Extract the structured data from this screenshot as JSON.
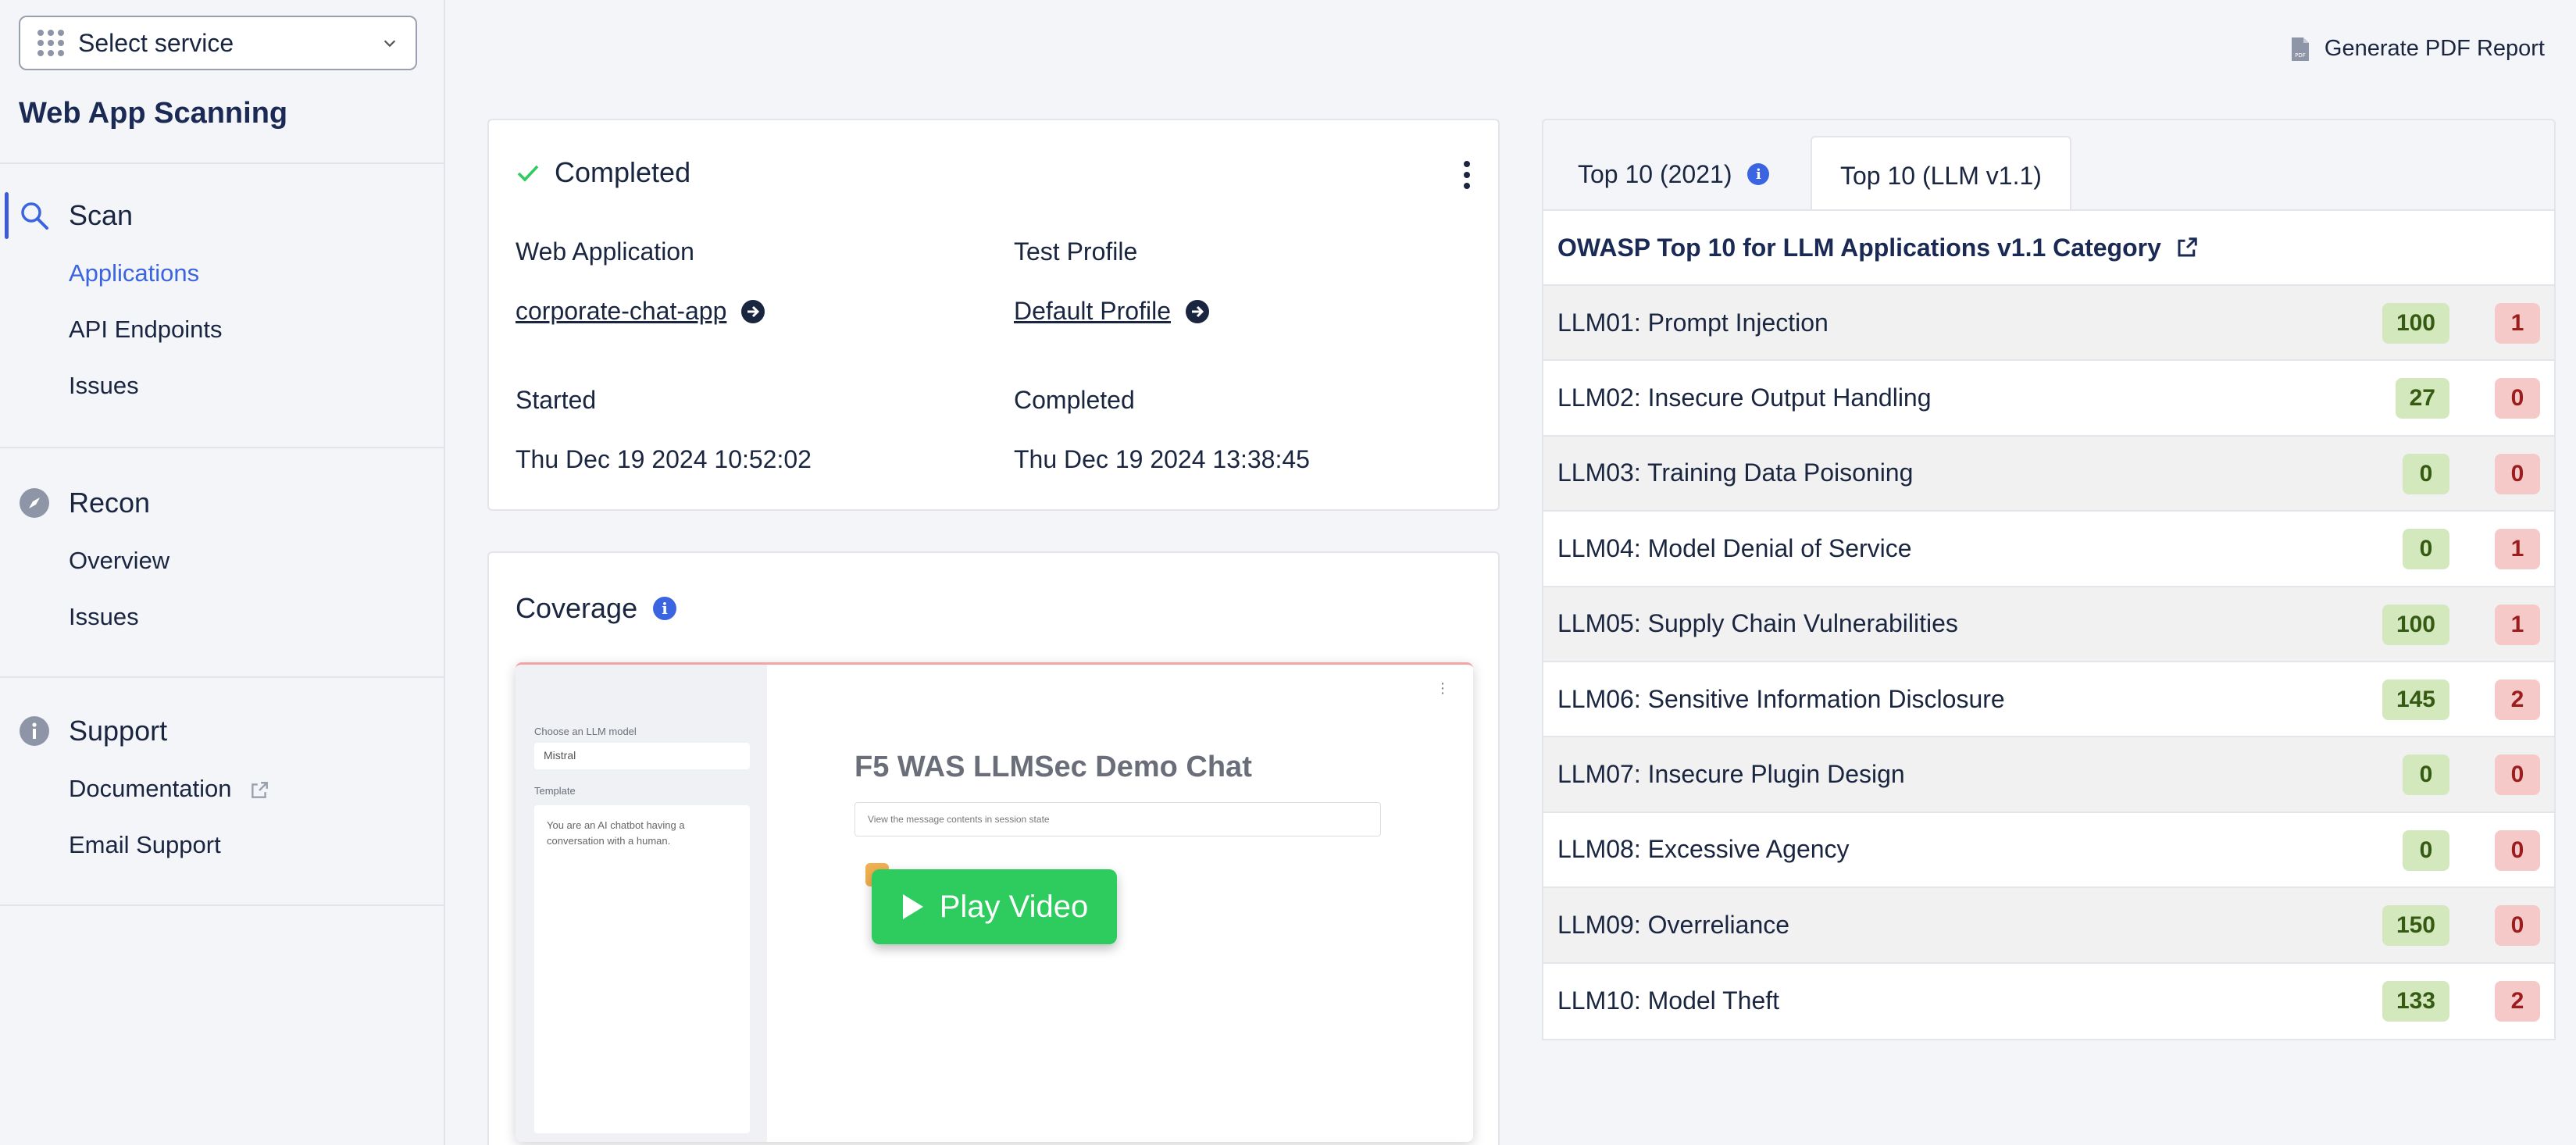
{
  "sidebar": {
    "service_select": "Select service",
    "app_title": "Web App Scanning",
    "scan": {
      "label": "Scan",
      "items": [
        "Applications",
        "API Endpoints",
        "Issues"
      ]
    },
    "recon": {
      "label": "Recon",
      "items": [
        "Overview",
        "Issues"
      ]
    },
    "support": {
      "label": "Support",
      "items": [
        "Documentation",
        "Email Support"
      ]
    }
  },
  "header": {
    "pdf_button": "Generate PDF Report"
  },
  "scan_status": {
    "status": "Completed",
    "web_application_label": "Web Application",
    "web_application_value": "corporate-chat-app",
    "test_profile_label": "Test Profile",
    "test_profile_value": "Default Profile",
    "started_label": "Started",
    "started_value": "Thu Dec 19 2024 10:52:02",
    "completed_label": "Completed",
    "completed_value": "Thu Dec 19 2024 13:38:45"
  },
  "coverage": {
    "title": "Coverage",
    "video": {
      "model_label": "Choose an LLM model",
      "model_value": "Mistral",
      "template_label": "Template",
      "template_text": "You are an AI chatbot having a conversation with a human.",
      "chat_title": "F5 WAS LLMSec Demo Chat",
      "expander_text": "View the message contents in session state",
      "play_label": "Play Video"
    }
  },
  "owasp": {
    "tabs": [
      "Top 10 (2021)",
      "Top 10 (LLM v1.1)"
    ],
    "active_tab": "Top 10 (LLM v1.1)",
    "table_title": "OWASP Top 10 for LLM Applications v1.1 Category",
    "rows": [
      {
        "name": "LLM01: Prompt Injection",
        "green": "100",
        "red": "1"
      },
      {
        "name": "LLM02: Insecure Output Handling",
        "green": "27",
        "red": "0"
      },
      {
        "name": "LLM03: Training Data Poisoning",
        "green": "0",
        "red": "0"
      },
      {
        "name": "LLM04: Model Denial of Service",
        "green": "0",
        "red": "1"
      },
      {
        "name": "LLM05: Supply Chain Vulnerabilities",
        "green": "100",
        "red": "1"
      },
      {
        "name": "LLM06: Sensitive Information Disclosure",
        "green": "145",
        "red": "2"
      },
      {
        "name": "LLM07: Insecure Plugin Design",
        "green": "0",
        "red": "0"
      },
      {
        "name": "LLM08: Excessive Agency",
        "green": "0",
        "red": "0"
      },
      {
        "name": "LLM09: Overreliance",
        "green": "150",
        "red": "0"
      },
      {
        "name": "LLM10: Model Theft",
        "green": "133",
        "red": "2"
      }
    ]
  },
  "colors": {
    "accent": "#3b64e0",
    "success": "#2ecc5e",
    "badge_green_bg": "#d3e8bd",
    "badge_red_bg": "#f6c9c9"
  }
}
